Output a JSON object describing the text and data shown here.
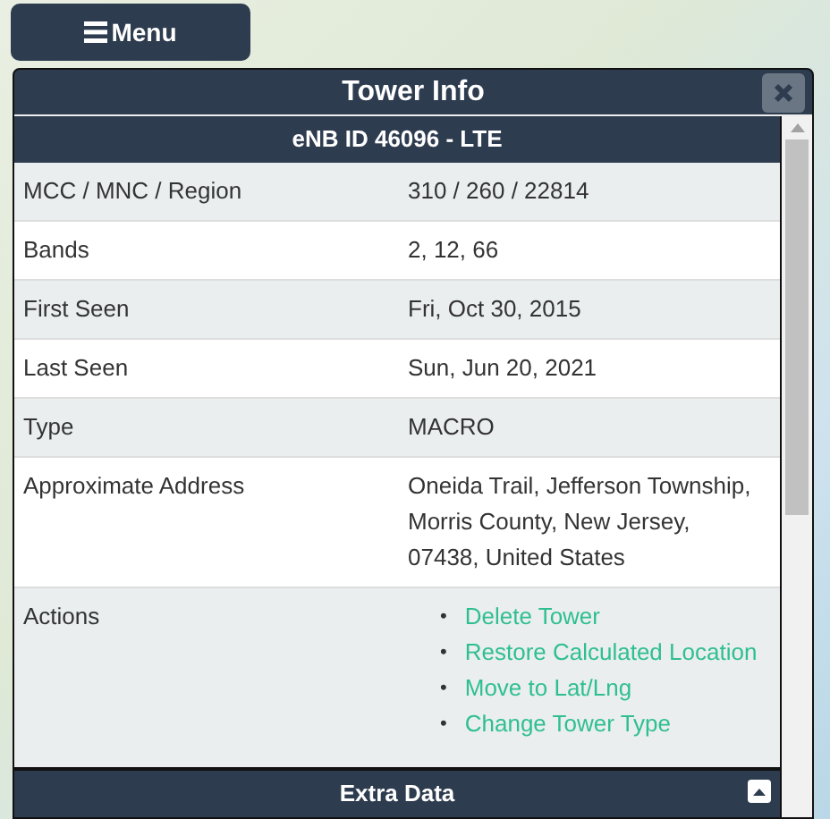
{
  "menu_button": {
    "label": "Menu"
  },
  "panel": {
    "title": "Tower Info",
    "subtitle": "eNB ID 46096 - LTE",
    "rows": [
      {
        "label": "MCC / MNC / Region",
        "value": "310 / 260 / 22814"
      },
      {
        "label": "Bands",
        "value": "2, 12, 66"
      },
      {
        "label": "First Seen",
        "value": "Fri, Oct 30, 2015"
      },
      {
        "label": "Last Seen",
        "value": "Sun, Jun 20, 2021"
      },
      {
        "label": "Type",
        "value": "MACRO"
      },
      {
        "label": "Approximate Address",
        "value": "Oneida Trail, Jefferson Township, Morris County, New Jersey, 07438, United States"
      }
    ],
    "actions": {
      "label": "Actions",
      "links": [
        {
          "bullet": "•",
          "text": "Delete Tower"
        },
        {
          "bullet": "•",
          "text": "Restore Calculated Location"
        },
        {
          "bullet": "•",
          "text": "Move to Lat/Lng"
        },
        {
          "bullet": "•",
          "text": "Change Tower Type"
        }
      ]
    },
    "extra_section": {
      "title": "Extra Data",
      "expanded": true
    }
  }
}
